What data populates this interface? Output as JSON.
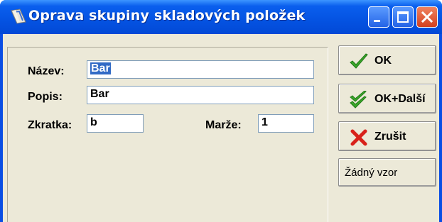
{
  "window": {
    "title": "Oprava skupiny skladových položek"
  },
  "form": {
    "nazev_label": "Název:",
    "nazev_value": "Bar",
    "popis_label": "Popis:",
    "popis_value": "Bar",
    "zkratka_label": "Zkratka:",
    "zkratka_value": "b",
    "marze_label": "Marže:",
    "marze_value": "1"
  },
  "buttons": {
    "ok_label": "OK",
    "ok_next_label": "OK+Další",
    "cancel_label": "Zrušit",
    "template_label": "Žádný vzor"
  },
  "icons": {
    "app": "app-icon",
    "ok": "checkmark-icon",
    "ok_next": "double-checkmark-icon",
    "cancel": "red-x-icon"
  },
  "colors": {
    "titlebar": "#0554e3",
    "selection": "#316ac5",
    "dialog_bg": "#ece9d8",
    "check_green": "#3aa52a",
    "cancel_red": "#d8211a"
  }
}
